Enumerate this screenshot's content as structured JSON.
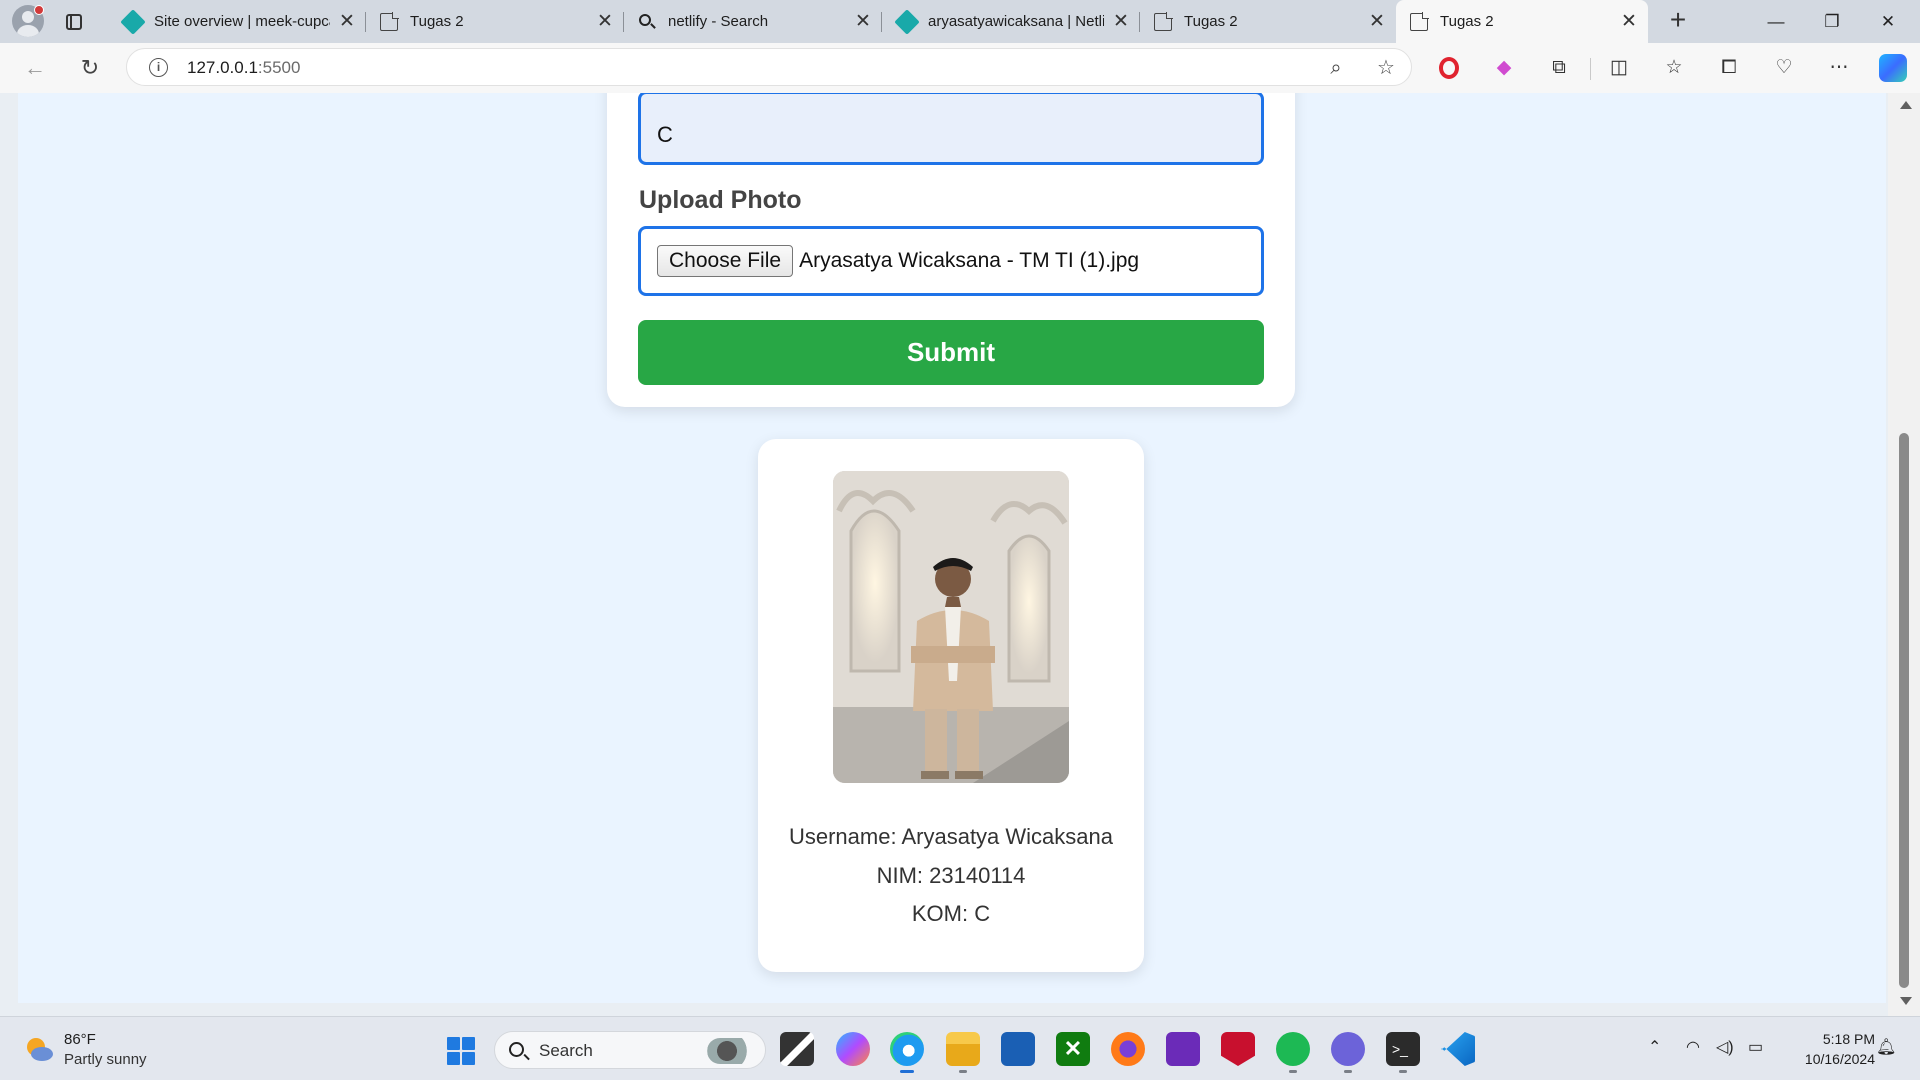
{
  "browser": {
    "tabs": [
      {
        "label": "Site overview | meek-cupcake",
        "favicon": "netlify-icon"
      },
      {
        "label": "Tugas 2",
        "favicon": "page-icon"
      },
      {
        "label": "netlify - Search",
        "favicon": "search-icon"
      },
      {
        "label": "aryasatyawicaksana | Netlify",
        "favicon": "netlify-icon"
      },
      {
        "label": "Tugas 2",
        "favicon": "page-icon"
      },
      {
        "label": "Tugas 2",
        "favicon": "page-icon",
        "active": true
      }
    ],
    "url_host": "127.0.0.1",
    "url_port": ":5500"
  },
  "form": {
    "kom_value": "C",
    "upload_label": "Upload Photo",
    "choose_file_label": "Choose File",
    "file_name": "Aryasatya Wicaksana - TM TI (1).jpg",
    "submit_label": "Submit"
  },
  "profile": {
    "username": "Username: Aryasatya Wicaksana",
    "nim": "NIM: 23140114",
    "kom": "KOM: C"
  },
  "taskbar": {
    "weather_temp": "86°F",
    "weather_desc": "Partly sunny",
    "search_placeholder": "Search",
    "time": "5:18 PM",
    "date": "10/16/2024"
  },
  "colors": {
    "accent_blue": "#1e73e8",
    "submit_green": "#28a745",
    "page_bg": "#eaf4ff"
  }
}
